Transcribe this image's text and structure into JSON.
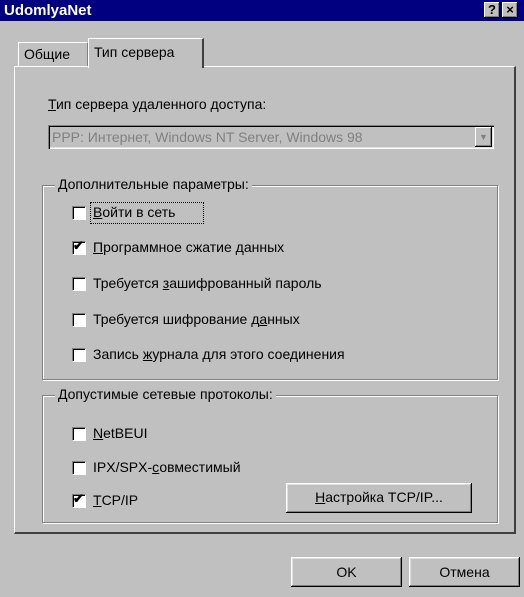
{
  "window": {
    "title": "UdomlyaNet",
    "help_glyph": "?",
    "close_glyph": "×"
  },
  "tabs": [
    {
      "label": "Общие",
      "active": false
    },
    {
      "label": "Тип сервера",
      "active": true
    }
  ],
  "server_type": {
    "label": "Тип сервера удаленного доступа:",
    "selected": "PPP: Интернет, Windows NT Server, Windows 98",
    "disabled": true
  },
  "advanced": {
    "legend": "Дополнительные параметры:",
    "options": [
      {
        "label": "Войти в сеть",
        "checked": false
      },
      {
        "label": "Программное сжатие данных",
        "checked": true
      },
      {
        "label": "Требуется зашифрованный пароль",
        "checked": false
      },
      {
        "label": "Требуется шифрование данных",
        "checked": false
      },
      {
        "label": "Запись журнала для этого соединения",
        "checked": false
      }
    ]
  },
  "protocols": {
    "legend": "Допустимые сетевые протоколы:",
    "options": [
      {
        "label": "NetBEUI",
        "checked": false
      },
      {
        "label": "IPX/SPX-совместимый",
        "checked": false
      },
      {
        "label": "TCP/IP",
        "checked": true
      }
    ],
    "tcpip_settings_button": "Настройка TCP/IP..."
  },
  "footer": {
    "ok_label": "OK",
    "cancel_label": "Отмена"
  },
  "checkmark_glyph": "✔"
}
